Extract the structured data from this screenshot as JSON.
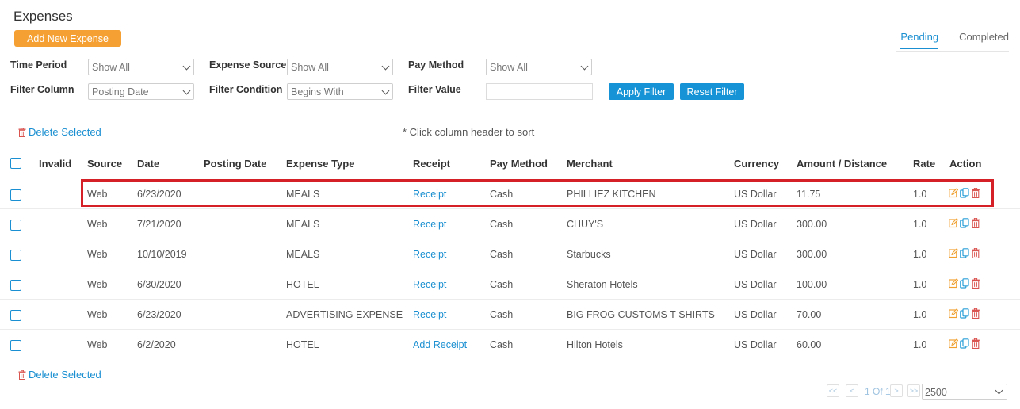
{
  "page": {
    "title": "Expenses",
    "add_button": "Add New Expense"
  },
  "tabs": [
    {
      "label": "Pending",
      "active": true
    },
    {
      "label": "Completed",
      "active": false
    }
  ],
  "filters": {
    "time_period": {
      "label": "Time Period",
      "value": "Show All"
    },
    "expense_source": {
      "label": "Expense Source",
      "value": "Show All"
    },
    "pay_method": {
      "label": "Pay Method",
      "value": "Show All"
    },
    "filter_column": {
      "label": "Filter Column",
      "value": "Posting Date"
    },
    "filter_condition": {
      "label": "Filter Condition",
      "value": "Begins With"
    },
    "filter_value": {
      "label": "Filter Value",
      "value": ""
    },
    "apply_button": "Apply Filter",
    "reset_button": "Reset Filter"
  },
  "delete_selected": "Delete Selected",
  "sort_note": "* Click column header to sort",
  "table": {
    "headers": [
      "Invalid",
      "Source",
      "Date",
      "Posting Date",
      "Expense Type",
      "Receipt",
      "Pay Method",
      "Merchant",
      "Currency",
      "Amount / Distance",
      "Rate",
      "Action"
    ],
    "rows": [
      {
        "invalid": "",
        "source": "Web",
        "date": "6/23/2020",
        "posting_date": "",
        "expense_type": "MEALS",
        "receipt": "Receipt",
        "pay_method": "Cash",
        "merchant": "PHILLIEZ KITCHEN",
        "currency": "US Dollar",
        "amount": "11.75",
        "rate": "1.0",
        "highlighted": true
      },
      {
        "invalid": "",
        "source": "Web",
        "date": "7/21/2020",
        "posting_date": "",
        "expense_type": "MEALS",
        "receipt": "Receipt",
        "pay_method": "Cash",
        "merchant": "CHUY'S",
        "currency": "US Dollar",
        "amount": "300.00",
        "rate": "1.0",
        "highlighted": false
      },
      {
        "invalid": "",
        "source": "Web",
        "date": "10/10/2019",
        "posting_date": "",
        "expense_type": "MEALS",
        "receipt": "Receipt",
        "pay_method": "Cash",
        "merchant": "Starbucks",
        "currency": "US Dollar",
        "amount": "300.00",
        "rate": "1.0",
        "highlighted": false
      },
      {
        "invalid": "",
        "source": "Web",
        "date": "6/30/2020",
        "posting_date": "",
        "expense_type": "HOTEL",
        "receipt": "Receipt",
        "pay_method": "Cash",
        "merchant": "Sheraton Hotels",
        "currency": "US Dollar",
        "amount": "100.00",
        "rate": "1.0",
        "highlighted": false
      },
      {
        "invalid": "",
        "source": "Web",
        "date": "6/23/2020",
        "posting_date": "",
        "expense_type": "ADVERTISING EXPENSE",
        "receipt": "Receipt",
        "pay_method": "Cash",
        "merchant": "BIG FROG CUSTOMS T-SHIRTS",
        "currency": "US Dollar",
        "amount": "70.00",
        "rate": "1.0",
        "highlighted": false
      },
      {
        "invalid": "",
        "source": "Web",
        "date": "6/2/2020",
        "posting_date": "",
        "expense_type": "HOTEL",
        "receipt": "Add Receipt",
        "pay_method": "Cash",
        "merchant": "Hilton Hotels",
        "currency": "US Dollar",
        "amount": "60.00",
        "rate": "1.0",
        "highlighted": false
      }
    ]
  },
  "pagination": {
    "first": "<<",
    "prev": "<",
    "info": "1 Of 1",
    "next": ">",
    "last": ">>",
    "page_size": "2500"
  },
  "icons": {
    "edit": "edit-icon",
    "copy": "copy-icon",
    "delete": "trash-icon"
  },
  "colors": {
    "accent": "#1a8fd1",
    "add_button": "#f5a033",
    "highlight": "#d62027",
    "edit": "#f0a030",
    "delete": "#d9534f"
  }
}
